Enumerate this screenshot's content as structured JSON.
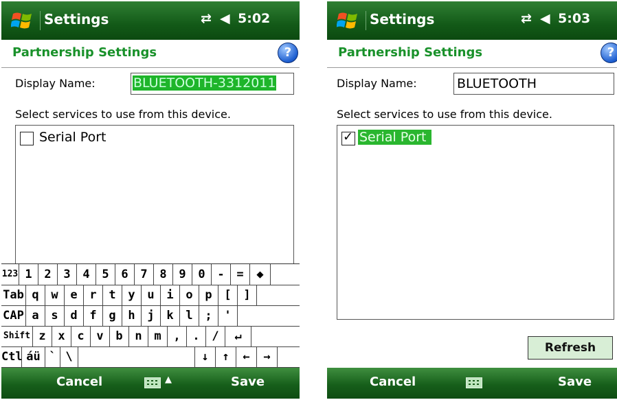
{
  "screens": [
    {
      "title": "Settings",
      "time": "5:02",
      "subheader": "Partnership Settings",
      "display_name_label": "Display Name:",
      "display_name_value": "BLUETOOTH-3312011",
      "services_prompt": "Select services to use from this device.",
      "service": {
        "label": "Serial Port",
        "checked": false
      },
      "softkeys": {
        "left": "Cancel",
        "right": "Save"
      }
    },
    {
      "title": "Settings",
      "time": "5:03",
      "subheader": "Partnership Settings",
      "display_name_label": "Display Name:",
      "display_name_value": "BLUETOOTH",
      "services_prompt": "Select services to use from this device.",
      "service": {
        "label": "Serial Port",
        "checked": true
      },
      "refresh_label": "Refresh",
      "softkeys": {
        "left": "Cancel",
        "right": "Save"
      }
    }
  ],
  "icons": {
    "start": "windows-flag-icon",
    "connectivity": "connectivity-arrows-icon",
    "volume": "speaker-icon",
    "help": "help-icon",
    "keyboard": "keyboard-icon",
    "check": "checkmark-icon"
  },
  "status_glyphs": {
    "connectivity": "⇄",
    "volume": "◀"
  },
  "help_glyph": "?",
  "check_glyph": "✓",
  "kb_arrow_glyph": "▲",
  "keyboard_rows": [
    [
      "123",
      "1",
      "2",
      "3",
      "4",
      "5",
      "6",
      "7",
      "8",
      "9",
      "0",
      "-",
      "=",
      "◆"
    ],
    [
      "Tab",
      "q",
      "w",
      "e",
      "r",
      "t",
      "y",
      "u",
      "i",
      "o",
      "p",
      "[",
      "]"
    ],
    [
      "CAP",
      "a",
      "s",
      "d",
      "f",
      "g",
      "h",
      "j",
      "k",
      "l",
      ";",
      "'"
    ],
    [
      "Shift",
      "z",
      "x",
      "c",
      "v",
      "b",
      "n",
      "m",
      ",",
      ".",
      "/",
      "↵"
    ],
    [
      "Ctl",
      "áü",
      "`",
      "\\",
      "",
      "↓",
      "↑",
      "←",
      "→"
    ]
  ],
  "colors": {
    "titlebar_green": "#135a18",
    "subheader_text": "#19912a",
    "selection_green": "#1eb52a",
    "refresh_bg": "#d8eed6"
  }
}
